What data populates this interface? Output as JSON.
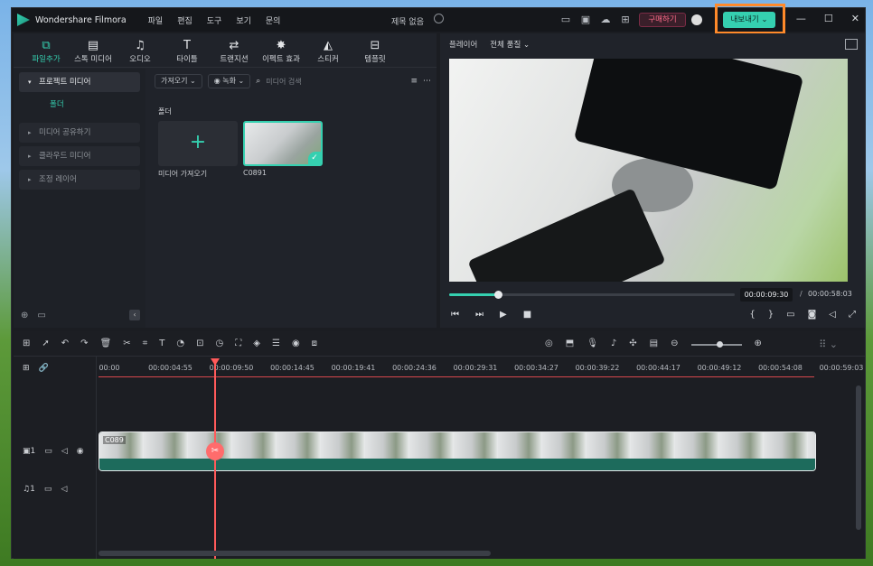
{
  "app": {
    "name": "Wondershare Filmora",
    "menu": [
      "파일",
      "편집",
      "도구",
      "보기",
      "문의"
    ],
    "project_title": "제목 없음",
    "buy_label": "구매하기",
    "export_label": "내보내기",
    "accent_color": "#35d0b0",
    "highlight_color": "#ff8a2a"
  },
  "tabs": [
    {
      "label": "파일추가",
      "icon": "media-icon",
      "active": true
    },
    {
      "label": "스톡 미디어",
      "icon": "stock-media-icon"
    },
    {
      "label": "오디오",
      "icon": "music-note-icon"
    },
    {
      "label": "타이틀",
      "icon": "title-t-icon"
    },
    {
      "label": "트랜지션",
      "icon": "transition-icon"
    },
    {
      "label": "이펙트 효과",
      "icon": "effects-icon"
    },
    {
      "label": "스티커",
      "icon": "sticker-icon"
    },
    {
      "label": "템플릿",
      "icon": "template-icon"
    }
  ],
  "sidebar": {
    "items": [
      "프로젝트 미디어",
      "미디어 공유하기",
      "클라우드 미디어",
      "조정 레이어"
    ],
    "sub_item": "폴더"
  },
  "media": {
    "import_dropdown": "가져오기",
    "record_dropdown": "녹화",
    "search_placeholder": "미디어 검색",
    "folder_label": "폴더",
    "import_tile_label": "미디어 가져오기",
    "clip_name": "C0891"
  },
  "preview": {
    "player_label": "플레이어",
    "quality": "전체 품질",
    "current_time": "00:00:09:30",
    "separator": "/",
    "total_time": "00:00:58:03",
    "progress": 0.17
  },
  "timeline": {
    "ruler": [
      "00:00",
      "00:00:04:55",
      "00:00:09:50",
      "00:00:14:45",
      "00:00:19:41",
      "00:00:24:36",
      "00:00:29:31",
      "00:00:34:27",
      "00:00:39:22",
      "00:00:44:17",
      "00:00:49:12",
      "00:00:54:08",
      "00:00:59:03"
    ],
    "video_track_num": "1",
    "audio_track_num": "1",
    "clip_label": "C089",
    "playhead_position": 0.163
  }
}
